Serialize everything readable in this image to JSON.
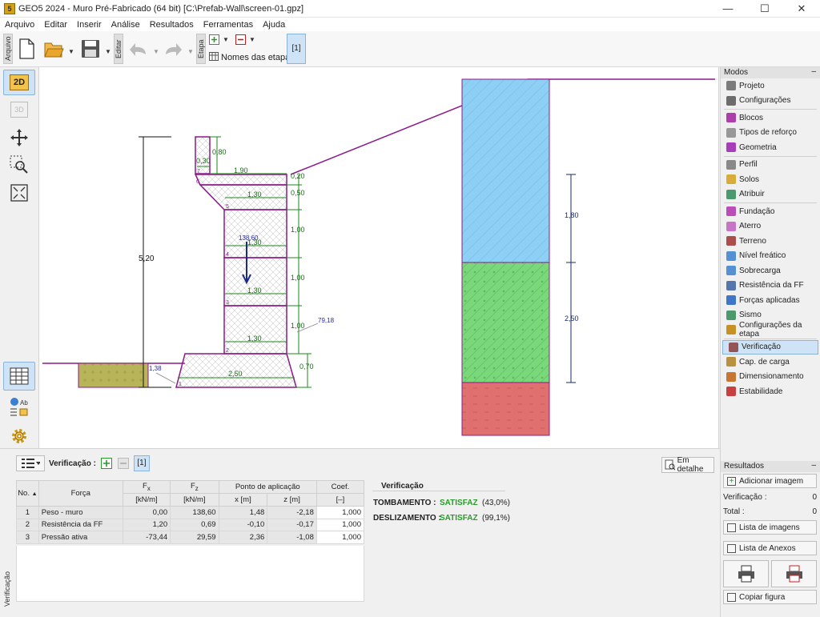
{
  "window": {
    "title": "GEO5 2024 - Muro Pré-Fabricado  (64 bit) [C:\\Prefab-Wall\\screen-01.gpz]",
    "app_icon_text": "5"
  },
  "menu": [
    "Arquivo",
    "Editar",
    "Inserir",
    "Análise",
    "Resultados",
    "Ferramentas",
    "Ajuda"
  ],
  "toolbar": {
    "arquivo_tab": "Arquivo",
    "editar_tab": "Editar",
    "etapa_tab": "Etapa",
    "stage_names_label": "Nomes das etapas",
    "stage_button": "[1]"
  },
  "left_tools": {
    "mode_2d": "2D",
    "mode_3d": "3D"
  },
  "drawing": {
    "dims": {
      "total_height": "5,20",
      "cap_height": "0,80",
      "cap_width": "0,30",
      "top_width": "1,90",
      "top_thk": "0,20",
      "b5": "1,30",
      "h5": "0,50",
      "b4": "1,30",
      "h4": "1,00",
      "b3": "1,30",
      "h3": "1,00",
      "b2": "1,30",
      "h2": "1,00",
      "base_w": "2,50",
      "base_h": "0,70",
      "force_value": "138,60",
      "active_force": "79,18",
      "passive_force": "1,38",
      "layer1_h": "1,80",
      "layer2_h": "2,50",
      "block_nums": [
        "7",
        "6",
        "5",
        "4",
        "3",
        "2",
        "1"
      ]
    }
  },
  "modes": {
    "header": "Modos",
    "groups": [
      [
        {
          "label": "Projeto",
          "icon": "project-icon",
          "color": "#666"
        },
        {
          "label": "Configurações",
          "icon": "gear-icon",
          "color": "#555"
        }
      ],
      [
        {
          "label": "Blocos",
          "icon": "blocks-icon",
          "color": "#a020a0"
        },
        {
          "label": "Tipos de reforço",
          "icon": "reinforcement-icon",
          "color": "#888"
        },
        {
          "label": "Geometria",
          "icon": "geometry-icon",
          "color": "#9b1fb0"
        }
      ],
      [
        {
          "label": "Perfil",
          "icon": "profile-icon",
          "color": "#777"
        },
        {
          "label": "Solos",
          "icon": "soils-icon",
          "color": "#d4a017"
        },
        {
          "label": "Atribuir",
          "icon": "assign-icon",
          "color": "#2e8b57"
        }
      ],
      [
        {
          "label": "Fundação",
          "icon": "foundation-icon",
          "color": "#b030b0"
        },
        {
          "label": "Aterro",
          "icon": "backfill-icon",
          "color": "#c060c0"
        },
        {
          "label": "Terreno",
          "icon": "terrain-icon",
          "color": "#a03030"
        },
        {
          "label": "Nível freático",
          "icon": "water-table-icon",
          "color": "#3a7fd0"
        },
        {
          "label": "Sobrecarga",
          "icon": "surcharge-icon",
          "color": "#3a7fd0"
        },
        {
          "label": "Resistência da FF",
          "icon": "front-resistance-icon",
          "color": "#3a60a0"
        },
        {
          "label": "Forças aplicadas",
          "icon": "applied-forces-icon",
          "color": "#2060c0"
        },
        {
          "label": "Sismo",
          "icon": "earthquake-icon",
          "color": "#2e8b57"
        },
        {
          "label": "Configurações da etapa",
          "icon": "stage-settings-icon",
          "color": "#c08000"
        }
      ],
      [
        {
          "label": "Verificação",
          "icon": "verification-icon",
          "color": "#8a3a3a",
          "active": true
        },
        {
          "label": "Cap. de carga",
          "icon": "bearing-capacity-icon",
          "color": "#b08020"
        },
        {
          "label": "Dimensionamento",
          "icon": "dimensioning-icon",
          "color": "#c06010"
        },
        {
          "label": "Estabilidade",
          "icon": "stability-icon",
          "color": "#c02020"
        }
      ]
    ]
  },
  "results_panel": {
    "header": "Resultados",
    "add_image": "Adicionar imagem",
    "verificacao_label": "Verificação :",
    "verificacao_count": "0",
    "total_label": "Total :",
    "total_count": "0",
    "image_list": "Lista de imagens",
    "attachments_list": "Lista de Anexos",
    "copy_figure": "Copiar figura"
  },
  "bottom": {
    "side_label": "Verificação",
    "toolbar_label": "Verificação :",
    "stage": "[1]",
    "detail_button": "Em detalhe",
    "table": {
      "headers": [
        "No.",
        "Força",
        "F",
        "F",
        "Ponto de aplicação",
        "Coef."
      ],
      "sub": [
        "x",
        "z"
      ],
      "units": [
        "[kN/m]",
        "[kN/m]",
        "x [m]",
        "z [m]",
        "[–]"
      ],
      "rows": [
        [
          "1",
          "Peso - muro",
          "0,00",
          "138,60",
          "1,48",
          "-2,18",
          "1,000"
        ],
        [
          "2",
          "Resistência da FF",
          "1,20",
          "0,69",
          "-0,10",
          "-0,17",
          "1,000"
        ],
        [
          "3",
          "Pressão ativa",
          "-73,44",
          "29,59",
          "2,36",
          "-1,08",
          "1,000"
        ]
      ]
    },
    "results": {
      "title": "Verificação",
      "tomb_label": "TOMBAMENTO :",
      "tomb_status": "SATISFAZ",
      "tomb_pct": "(43,0%)",
      "desl_label": "DESLIZAMENTO :",
      "desl_status": "SATISFAZ",
      "desl_pct": "(99,1%)"
    }
  }
}
